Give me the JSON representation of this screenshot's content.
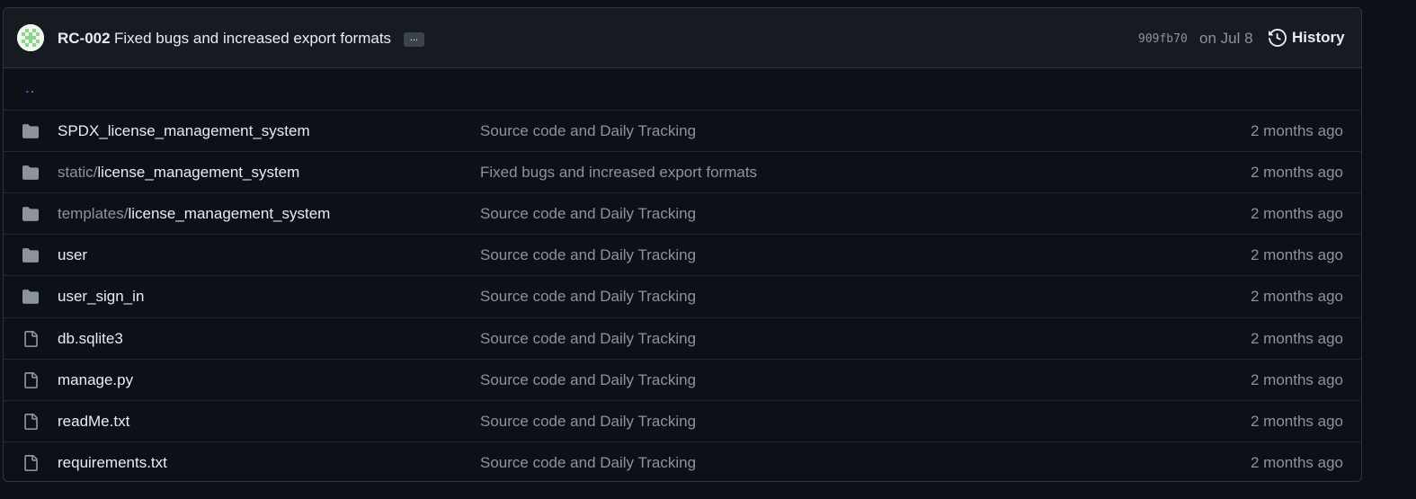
{
  "commit": {
    "author": "RC-002",
    "message": "Fixed bugs and increased export formats",
    "ellipsis": "...",
    "sha": "909fb70",
    "date": "on Jul 8",
    "history_label": "History"
  },
  "parent_link": "..",
  "files": [
    {
      "type": "folder",
      "prefix": "",
      "name": "SPDX_license_management_system",
      "message": "Source code and Daily Tracking",
      "age": "2 months ago"
    },
    {
      "type": "folder",
      "prefix": "static/",
      "name": "license_management_system",
      "message": "Fixed bugs and increased export formats",
      "age": "2 months ago"
    },
    {
      "type": "folder",
      "prefix": "templates/",
      "name": "license_management_system",
      "message": "Source code and Daily Tracking",
      "age": "2 months ago"
    },
    {
      "type": "folder",
      "prefix": "",
      "name": "user",
      "message": "Source code and Daily Tracking",
      "age": "2 months ago"
    },
    {
      "type": "folder",
      "prefix": "",
      "name": "user_sign_in",
      "message": "Source code and Daily Tracking",
      "age": "2 months ago"
    },
    {
      "type": "file",
      "prefix": "",
      "name": "db.sqlite3",
      "message": "Source code and Daily Tracking",
      "age": "2 months ago"
    },
    {
      "type": "file",
      "prefix": "",
      "name": "manage.py",
      "message": "Source code and Daily Tracking",
      "age": "2 months ago"
    },
    {
      "type": "file",
      "prefix": "",
      "name": "readMe.txt",
      "message": "Source code and Daily Tracking",
      "age": "2 months ago"
    },
    {
      "type": "file",
      "prefix": "",
      "name": "requirements.txt",
      "message": "Source code and Daily Tracking",
      "age": "2 months ago"
    }
  ],
  "colors": {
    "background": "#0d1117",
    "header_bg": "#161b22",
    "text": "#e6edf3",
    "muted": "#8b949e",
    "link": "#4493f8",
    "border": "#30363d"
  }
}
